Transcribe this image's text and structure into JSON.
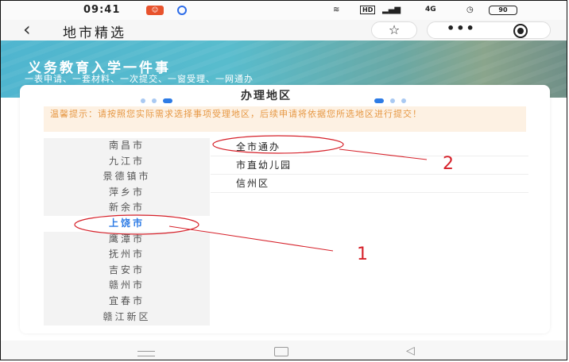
{
  "status_bar": {
    "time": "09:41",
    "notification_1": "☺",
    "notification_2": "◎",
    "network": "HD",
    "signal": "4G",
    "battery": "90"
  },
  "nav": {
    "title": "地市精选",
    "back_icon": "chevron-left-icon",
    "favorite_icon": "star-icon",
    "more_icon": "more-icon",
    "close_icon": "target-icon"
  },
  "banner": {
    "title": "义务教育入学一件事",
    "subtitle": "一表申请、一套材料、一次提交、一窗受理、一网通办"
  },
  "card": {
    "title": "办理地区",
    "tip": "温馨提示：请按照您实际需求选择事项受理地区，后续申请将依据您所选地区进行提交！"
  },
  "cities": [
    {
      "label": "南昌市",
      "active": false
    },
    {
      "label": "九江市",
      "active": false
    },
    {
      "label": "景德镇市",
      "active": false
    },
    {
      "label": "萍乡市",
      "active": false
    },
    {
      "label": "新余市",
      "active": false
    },
    {
      "label": "上饶市",
      "active": true
    },
    {
      "label": "鹰潭市",
      "active": false
    },
    {
      "label": "抚州市",
      "active": false
    },
    {
      "label": "吉安市",
      "active": false
    },
    {
      "label": "赣州市",
      "active": false
    },
    {
      "label": "宜春市",
      "active": false
    },
    {
      "label": "赣江新区",
      "active": false
    }
  ],
  "areas": [
    {
      "label": "全市通办"
    },
    {
      "label": "市直幼儿园"
    },
    {
      "label": "信州区"
    }
  ],
  "annotations": {
    "label_1": "1",
    "label_2": "2",
    "color": "#d6212a"
  },
  "colors": {
    "accent": "#2d7be5",
    "tip_text": "#e69844",
    "tip_bg": "#fdf1e3"
  }
}
